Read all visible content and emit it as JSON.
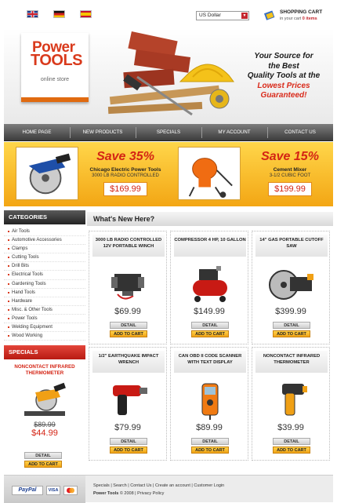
{
  "topbar": {
    "flags": [
      "English flag",
      "German flag",
      "Spanish flag"
    ],
    "currency": "US Dollar",
    "cart_title": "SHOPPING CART",
    "cart_prefix": "in your cart",
    "cart_items": "0 items"
  },
  "logo": {
    "line1": "Power",
    "line2": "TOOLS",
    "line3": "online store"
  },
  "tagline": {
    "line1": "Your Source for",
    "line2": "the Best",
    "line3": "Quality Tools at the",
    "line4": "Lowest Prices",
    "line5": "Guaranteed!"
  },
  "nav": [
    "HOME PAGE",
    "NEW PRODUCTS",
    "SPECIALS",
    "MY ACCOUNT",
    "CONTACT US"
  ],
  "promos": [
    {
      "save": "Save 35%",
      "name": "Chicago Electric Power Tools",
      "desc": "3000 LB RADIO CONTROLLED",
      "price": "$169.99"
    },
    {
      "save": "Save 15%",
      "name": "Cement Mixer",
      "desc": "3-1/2 CUBIC FOOT",
      "price": "$199.99"
    }
  ],
  "sidebar": {
    "categories_title": "CATEGORIES",
    "categories": [
      "Air Tools",
      "Automotive Accessories",
      "Clamps",
      "Cutting Tools",
      "Drill Bits",
      "Electrical Tools",
      "Gardening Tools",
      "Hand Tools",
      "Hardware",
      "Misc. & Other Tools",
      "Power Tools",
      "Welding Equipment",
      "Wood Working"
    ],
    "specials_title": "SPECIALS",
    "special": {
      "name_line1": "NONCONTACT INFRARED",
      "name_line2": "THERMOMETER",
      "old_price": "$89.99",
      "new_price": "$44.99",
      "detail": "DETAIL",
      "add": "ADD TO CART"
    }
  },
  "main": {
    "title": "What's New Here?",
    "detail_label": "DETAIL",
    "cart_label": "ADD TO CART",
    "products": [
      {
        "title": "3000 LB RADIO CONTROLLED 12V PORTABLE WINCH",
        "price": "$69.99",
        "icon": "winch-icon"
      },
      {
        "title": "COMPRESSOR 4 HP, 10 GALLON",
        "price": "$149.99",
        "icon": "compressor-icon"
      },
      {
        "title": "14\" GAS PORTABLE CUTOFF SAW",
        "price": "$399.99",
        "icon": "cutoff-saw-icon"
      },
      {
        "title": "1/2\" EARTHQUAKE IMPACT WRENCH",
        "price": "$79.99",
        "icon": "impact-wrench-icon"
      },
      {
        "title": "CAN OBD II CODE SCANNER WITH TEXT DISPLAY",
        "price": "$89.99",
        "icon": "code-scanner-icon"
      },
      {
        "title": "NONCONTACT INFRARED THERMOMETER",
        "price": "$39.99",
        "icon": "thermometer-icon"
      }
    ]
  },
  "footer": {
    "links": [
      "Specials",
      "Search",
      "Contact Us",
      "Create an account",
      "Customer Login"
    ],
    "brand": "Power Tools",
    "copy": "© 2008",
    "privacy": "Privacy Policy",
    "paypal": "PayPal",
    "visa": "VISA"
  },
  "colors": {
    "accent_red": "#d42414",
    "accent_orange": "#f3a614",
    "nav_dark": "#3c3c3c"
  }
}
